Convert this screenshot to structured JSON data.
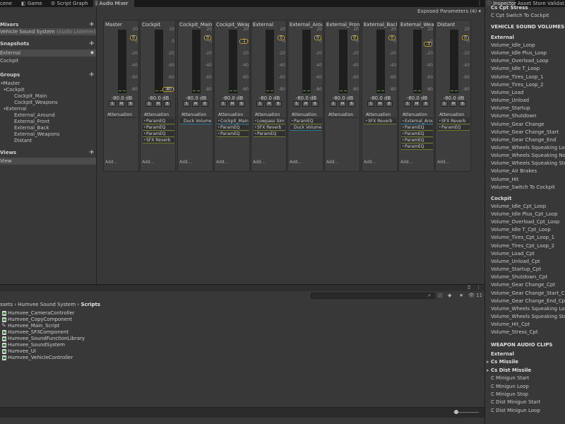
{
  "tabs": {
    "scene": "cene",
    "game": "Game",
    "script_graph": "Script Graph",
    "audio_mixer": "Audio Mixer"
  },
  "mixer": {
    "exposed_params": "Exposed Parameters (4)",
    "sections": {
      "mixers": "Mixers",
      "snapshots": "Snapshots",
      "groups": "Groups",
      "views": "Views"
    },
    "mixers": [
      {
        "name": "Vehicle Sound System",
        "sub": "(Audio Listener) - Ec"
      }
    ],
    "snapshots": [
      "External",
      "Cockpit"
    ],
    "groups": [
      "Master",
      "Cockpit",
      "Cockpit_Main",
      "Cockpit_Weapons",
      "External",
      "External_Around",
      "External_Front",
      "External_Back",
      "External_Weapons",
      "Distant"
    ],
    "views": [
      "View"
    ],
    "scale_ticks": [
      "20",
      "0",
      "-20",
      "-40",
      "-60",
      "-80"
    ],
    "mute_buttons": [
      "S",
      "M",
      "B"
    ],
    "add_label": "Add...",
    "strips": [
      {
        "name": "Master",
        "db": "-80.0 dB",
        "fader": "0",
        "effects": [
          {
            "label": "Attenuation",
            "kind": "first"
          }
        ]
      },
      {
        "name": "Cockpit",
        "db": "-80.0 dB",
        "fader": "-80",
        "effects": [
          {
            "label": "Attenuation",
            "kind": "first"
          },
          {
            "label": "ParamEQ",
            "kind": "dot"
          },
          {
            "label": "ParamEQ",
            "kind": "dot"
          },
          {
            "label": "ParamEQ",
            "kind": "dot"
          },
          {
            "label": "SFX Reverb",
            "kind": "dot"
          }
        ]
      },
      {
        "name": "Cockpit_Main",
        "db": "-80.0 dB",
        "fader": "0",
        "effects": [
          {
            "label": "Attenuation",
            "kind": "first"
          },
          {
            "label": "Duck Volume",
            "kind": "send"
          }
        ]
      },
      {
        "name": "Cockpit_Weap",
        "db": "-80.0 dB",
        "fader": "-1",
        "effects": [
          {
            "label": "Attenuation",
            "kind": "first"
          },
          {
            "label": "Cockpit_Main",
            "kind": "dot send"
          },
          {
            "label": "ParamEQ",
            "kind": "dot"
          },
          {
            "label": "ParamEQ",
            "kind": "dot"
          }
        ]
      },
      {
        "name": "External",
        "db": "-80.0 dB",
        "fader": "0",
        "effects": [
          {
            "label": "Attenuation",
            "kind": "first"
          },
          {
            "label": "Lowpass Sim",
            "kind": "dot"
          },
          {
            "label": "SFX Reverb",
            "kind": "dot"
          },
          {
            "label": "ParamEQ",
            "kind": "dot"
          }
        ]
      },
      {
        "name": "External_Arou",
        "db": "-80.0 dB",
        "fader": "0",
        "effects": [
          {
            "label": "Attenuation",
            "kind": "first"
          },
          {
            "label": "ParamEQ",
            "kind": "dot"
          },
          {
            "label": "Duck Volume",
            "kind": "send"
          }
        ]
      },
      {
        "name": "External_Fron",
        "db": "-80.0 dB",
        "fader": "0",
        "effects": [
          {
            "label": "Attenuation",
            "kind": "first"
          }
        ]
      },
      {
        "name": "External_Back",
        "db": "-80.0 dB",
        "fader": "0",
        "effects": [
          {
            "label": "Attenuation",
            "kind": "first"
          },
          {
            "label": "SFX Reverb",
            "kind": "dot"
          }
        ]
      },
      {
        "name": "External_Wea",
        "db": "-80.0 dB",
        "fader": "-3",
        "effects": [
          {
            "label": "Attenuation",
            "kind": "first"
          },
          {
            "label": "External_Arou",
            "kind": "dot send"
          },
          {
            "label": "ParamEQ",
            "kind": "dot"
          },
          {
            "label": "ParamEQ",
            "kind": "dot"
          },
          {
            "label": "ParamEQ",
            "kind": "dot"
          },
          {
            "label": "ParamEQ",
            "kind": "dot"
          }
        ]
      },
      {
        "name": "Distant",
        "db": "-80.0 dB",
        "fader": "0",
        "effects": [
          {
            "label": "Attenuation",
            "kind": "first"
          },
          {
            "label": "SFX Reverb",
            "kind": "dot"
          },
          {
            "label": "ParamEQ",
            "kind": "dot"
          }
        ]
      }
    ]
  },
  "project": {
    "breadcrumb": [
      "ssets",
      "Humvee Sound System",
      "Scripts"
    ],
    "hidden_count": "11",
    "files": [
      {
        "name": "Humvee_CameraController",
        "icon": "cs"
      },
      {
        "name": "Humvee_CopyComponent",
        "icon": "cs"
      },
      {
        "name": "Humvee_Main_Script",
        "icon": "script"
      },
      {
        "name": "Humvee_SFXComponent",
        "icon": "cs"
      },
      {
        "name": "Humvee_SoundFunctionLibrary",
        "icon": "cs"
      },
      {
        "name": "Humvee_SoundSystem",
        "icon": "cs"
      },
      {
        "name": "Humvee_UI",
        "icon": "cs"
      },
      {
        "name": "Humvee_VehicleController",
        "icon": "cs"
      }
    ]
  },
  "inspector": {
    "tabs": [
      "Inspector",
      "Asset Store Validat"
    ],
    "top_partial": "Cs Cpt Stress",
    "top_item": "C Cpt Switch To Cockpit",
    "vehicle_header": "VEHICLE SOUND VOLUMES",
    "external_label": "External",
    "external_items": [
      "Volume_Idle_Loop",
      "Volume_Idle Plus_Loop",
      "Volume_Overload_Loop",
      "Volume_Idle T_Loop",
      "Volume_Tires_Loop_1",
      "Volume_Tires_Loop_2",
      "Volume_Load",
      "Volume_Unload",
      "Volume_Startup",
      "Volume_Shutdown",
      "Volume_Gear Change",
      "Volume_Gear Change_Start",
      "Volume_Gear Change_End",
      "Volume_Wheels Squeaking Loop",
      "Volume_Wheels Squeaking Noise",
      "Volume_Wheels Squeaking Stop",
      "Volume_Air Brakes",
      "Volume_Hit",
      "Volume_Switch To Cockpit"
    ],
    "cockpit_label": "Cockpit",
    "cockpit_items": [
      "Volume_Idle_Cpt_Loop",
      "Volume_Idle Plus_Cpt_Loop",
      "Volume_Overload_Cpt_Loop",
      "Volume_Idle T_Cpt_Loop",
      "Volume_Tires_Cpt_Loop_1",
      "Volume_Tires_Cpt_Loop_2",
      "Volume_Load_Cpt",
      "Volume_Unload_Cpt",
      "Volume_Startup_Cpt",
      "Volume_Shutdown_Cpt",
      "Volume_Gear Change_Cpt",
      "Volume_Gear Change_Start_Cpt",
      "Volume_Gear Change_End_Cpt",
      "Volume_Wheels Squeaking Loop_C",
      "Volume_Wheels Squeaking Stop_Cp",
      "Volume_Hit_Cpt",
      "Volume_Stress_Cpt"
    ],
    "weapon_header": "WEAPON AUDIO CLIPS",
    "weapon_external": "External",
    "weapon_folds": [
      "Cs Missile",
      "Cs Dist Missile"
    ],
    "weapon_items": [
      "C Minigun Start",
      "C Minigun Loop",
      "C Minigun Stop",
      "C Dist Minigun Start",
      "C Dist Minigun Loop"
    ]
  }
}
